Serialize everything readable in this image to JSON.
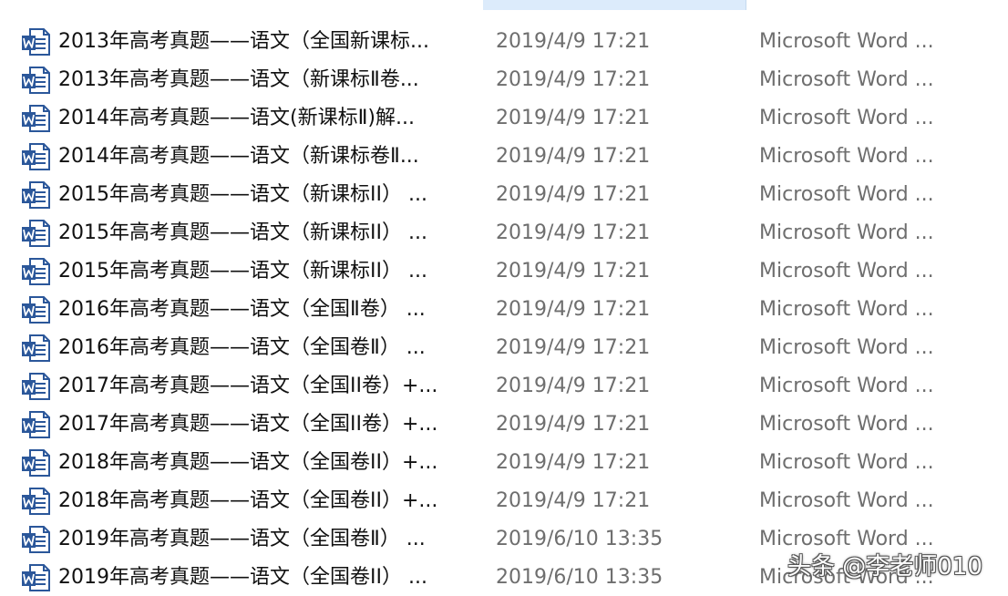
{
  "files": [
    {
      "name": "2013年高考真题——语文（全国新课标...",
      "date": "2019/4/9 17:21",
      "type": "Microsoft Word ..."
    },
    {
      "name": "2013年高考真题——语文（新课标Ⅱ卷...",
      "date": "2019/4/9 17:21",
      "type": "Microsoft Word ..."
    },
    {
      "name": "2014年高考真题——语文(新课标Ⅱ)解...",
      "date": "2019/4/9 17:21",
      "type": "Microsoft Word ..."
    },
    {
      "name": "2014年高考真题——语文（新课标卷Ⅱ...",
      "date": "2019/4/9 17:21",
      "type": "Microsoft Word ..."
    },
    {
      "name": "2015年高考真题——语文（新课标II） ...",
      "date": "2019/4/9 17:21",
      "type": "Microsoft Word ..."
    },
    {
      "name": "2015年高考真题——语文（新课标II） ...",
      "date": "2019/4/9 17:21",
      "type": "Microsoft Word ..."
    },
    {
      "name": "2015年高考真题——语文（新课标II） ...",
      "date": "2019/4/9 17:21",
      "type": "Microsoft Word ..."
    },
    {
      "name": "2016年高考真题——语文（全国Ⅱ卷） ...",
      "date": "2019/4/9 17:21",
      "type": "Microsoft Word ..."
    },
    {
      "name": "2016年高考真题——语文（全国卷Ⅱ） ...",
      "date": "2019/4/9 17:21",
      "type": "Microsoft Word ..."
    },
    {
      "name": "2017年高考真题——语文（全国II卷）+...",
      "date": "2019/4/9 17:21",
      "type": "Microsoft Word ..."
    },
    {
      "name": "2017年高考真题——语文（全国II卷）+...",
      "date": "2019/4/9 17:21",
      "type": "Microsoft Word ..."
    },
    {
      "name": "2018年高考真题——语文（全国卷II）+...",
      "date": "2019/4/9 17:21",
      "type": "Microsoft Word ..."
    },
    {
      "name": "2018年高考真题——语文（全国卷II）+...",
      "date": "2019/4/9 17:21",
      "type": "Microsoft Word ..."
    },
    {
      "name": "2019年高考真题——语文（全国卷Ⅱ） ...",
      "date": "2019/6/10 13:35",
      "type": "Microsoft Word ..."
    },
    {
      "name": "2019年高考真题——语文（全国卷II） ...",
      "date": "2019/6/10 13:35",
      "type": "Microsoft Word ..."
    }
  ],
  "file_icon": "word-document-icon",
  "watermark": "头条 @李老师010",
  "colors": {
    "icon_blue": "#2b579a",
    "header_highlight": "#dcebfb",
    "secondary_text": "#6e6e6e"
  }
}
